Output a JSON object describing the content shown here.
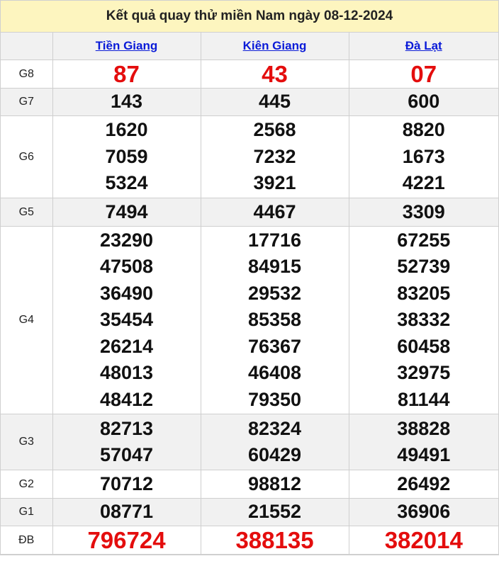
{
  "title": "Kết quả quay thử miền Nam ngày 08-12-2024",
  "provinces": [
    "Tiền Giang",
    "Kiên Giang",
    "Đà Lạt"
  ],
  "prizes": {
    "g8": {
      "label": "G8",
      "values": [
        [
          "87"
        ],
        [
          "43"
        ],
        [
          "07"
        ]
      ]
    },
    "g7": {
      "label": "G7",
      "values": [
        [
          "143"
        ],
        [
          "445"
        ],
        [
          "600"
        ]
      ]
    },
    "g6": {
      "label": "G6",
      "values": [
        [
          "1620",
          "7059",
          "5324"
        ],
        [
          "2568",
          "7232",
          "3921"
        ],
        [
          "8820",
          "1673",
          "4221"
        ]
      ]
    },
    "g5": {
      "label": "G5",
      "values": [
        [
          "7494"
        ],
        [
          "4467"
        ],
        [
          "3309"
        ]
      ]
    },
    "g4": {
      "label": "G4",
      "values": [
        [
          "23290",
          "47508",
          "36490",
          "35454",
          "26214",
          "48013",
          "48412"
        ],
        [
          "17716",
          "84915",
          "29532",
          "85358",
          "76367",
          "46408",
          "79350"
        ],
        [
          "67255",
          "52739",
          "83205",
          "38332",
          "60458",
          "32975",
          "81144"
        ]
      ]
    },
    "g3": {
      "label": "G3",
      "values": [
        [
          "82713",
          "57047"
        ],
        [
          "82324",
          "60429"
        ],
        [
          "38828",
          "49491"
        ]
      ]
    },
    "g2": {
      "label": "G2",
      "values": [
        [
          "70712"
        ],
        [
          "98812"
        ],
        [
          "26492"
        ]
      ]
    },
    "g1": {
      "label": "G1",
      "values": [
        [
          "08771"
        ],
        [
          "21552"
        ],
        [
          "36906"
        ]
      ]
    },
    "db": {
      "label": "ĐB",
      "values": [
        [
          "796724"
        ],
        [
          "388135"
        ],
        [
          "382014"
        ]
      ]
    }
  },
  "colors": {
    "title_bg": "#fdf5bf",
    "highlight_red": "#e40d0d",
    "link_blue": "#0a1bd8",
    "row_gray": "#f1f1f1"
  }
}
